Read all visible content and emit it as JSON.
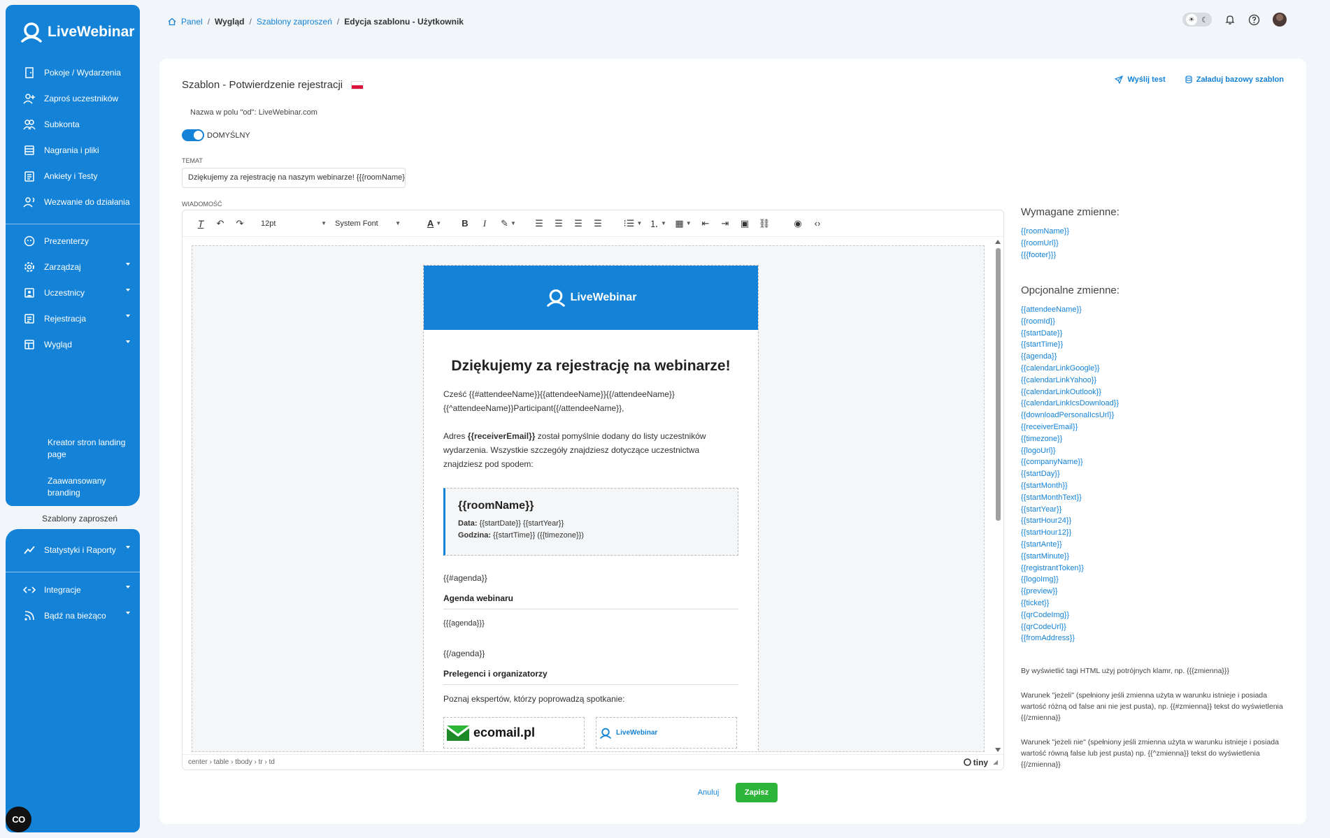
{
  "app": {
    "name": "LiveWebinar"
  },
  "sidebar": {
    "items": [
      {
        "label": "Pokoje / Wydarzenia",
        "icon": "door-icon"
      },
      {
        "label": "Zaproś uczestników",
        "icon": "user-plus-icon"
      },
      {
        "label": "Subkonta",
        "icon": "users-icon"
      },
      {
        "label": "Nagrania i pliki",
        "icon": "recordings-icon"
      },
      {
        "label": "Ankiety i Testy",
        "icon": "survey-icon"
      },
      {
        "label": "Wezwanie do działania",
        "icon": "call-to-action-icon"
      },
      {
        "label": "Prezenterzy",
        "icon": "presenter-icon"
      },
      {
        "label": "Zarządzaj",
        "icon": "gear-icon"
      },
      {
        "label": "Uczestnicy",
        "icon": "participants-icon"
      },
      {
        "label": "Rejestracja",
        "icon": "registration-icon"
      },
      {
        "label": "Wygląd",
        "icon": "layout-icon"
      },
      {
        "label": "Statystyki i Raporty",
        "icon": "chart-icon"
      },
      {
        "label": "Integracje",
        "icon": "integration-icon"
      },
      {
        "label": "Bądź na bieżąco",
        "icon": "rss-icon"
      }
    ],
    "subitems": [
      "Kreator stron landing page",
      "Zaawansowany branding",
      "Szablony zaproszeń"
    ],
    "badge": "CO"
  },
  "breadcrumb": {
    "home": "Panel",
    "section": "Wygląd",
    "templates": "Szablony zaproszeń",
    "current": "Edycja szablonu - Użytkownik"
  },
  "page": {
    "title": "Szablon - Potwierdzenie rejestracji",
    "send_test": "Wyślij test",
    "load_base": "Załaduj bazowy szablon",
    "from_name": "Nazwa w polu \"od\": LiveWebinar.com",
    "default_toggle": "DOMYŚLNY",
    "subject_label": "TEMAT",
    "subject_value": "Dziękujemy za rejestrację na naszym webinarze! {{{roomName}}}",
    "message_label": "WIADOMOŚĆ"
  },
  "editor": {
    "font_size": "12pt",
    "font_family": "System Font",
    "path": "center › table › tbody › tr › td",
    "brand": "tiny"
  },
  "email": {
    "logo": "LiveWebinar",
    "heading": "Dziękujemy za rejestrację na webinarze!",
    "greeting_1": "Cześć {{#attendeeName}}{{attendeeName}}{{/attendeeName}}",
    "greeting_2": "{{^attendeeName}}Participant{{/attendeeName}},",
    "address_prefix": "Adres ",
    "address_var": "{{receiverEmail}}",
    "address_rest": " został pomyślnie dodany do listy uczestników wydarzenia. Wszystkie szczegóły znajdziesz dotyczące uczestnictwa znajdziesz pod spodem:",
    "room": "{{roomName}}",
    "date_label": "Data:",
    "date_value": " {{startDate}} {{startYear}}",
    "time_label": "Godzina:",
    "time_value": " {{startTime}} ({{timezone}})",
    "agenda_open": "{{#agenda}}",
    "agenda_title": "Agenda webinaru",
    "agenda_value": "{{{agenda}}}",
    "agenda_close": "{{/agenda}}",
    "speakers_title": "Prelegenci i organizatorzy",
    "speakers_sub": "Poznaj ekspertów, którzy poprowadzą spotkanie:",
    "partner_1": "ecomail.pl",
    "partner_2": "LiveWebinar"
  },
  "variables": {
    "required_title": "Wymagane zmienne:",
    "required": [
      "{{roomName}}",
      "{{roomUrl}}",
      "{{{footer}}}"
    ],
    "optional_title": "Opcjonalne zmienne:",
    "optional": [
      "{{attendeeName}}",
      "{{roomId}}",
      "{{startDate}}",
      "{{startTime}}",
      "{{agenda}}",
      "{{calendarLinkGoogle}}",
      "{{calendarLinkYahoo}}",
      "{{calendarLinkOutlook}}",
      "{{calendarLinkIcsDownload}}",
      "{{downloadPersonalIcsUrl}}",
      "{{receiverEmail}}",
      "{{timezone}}",
      "{{logoUrl}}",
      "{{companyName}}",
      "{{startDay}}",
      "{{startMonth}}",
      "{{startMonthText}}",
      "{{startYear}}",
      "{{startHour24}}",
      "{{startHour12}}",
      "{{startAnte}}",
      "{{startMinute}}",
      "{{registrantToken}}",
      "{{logoImg}}",
      "{{preview}}",
      "{{ticket}}",
      "{{qrCodeImg}}",
      "{{qrCodeUrl}}",
      "{{fromAddress}}"
    ],
    "note_1": "By wyświetlić tagi HTML użyj potrójnych klamr, np. {{{zmienna}}}",
    "note_2": "Warunek \"jeżeli\" (spełniony jeśli zmienna użyta w warunku istnieje i posiada wartość różną od false ani nie jest pusta), np. {{#zmienna}} tekst do wyświetlenia {{/zmienna}}",
    "note_3": "Warunek \"jeżeli nie\" (spełniony jeśli zmienna użyta w warunku istnieje i posiada wartość równą false lub jest pusta) np. {{^zmienna}} tekst do wyświetlenia {{/zmienna}}"
  },
  "buttons": {
    "cancel": "Anuluj",
    "save": "Zapisz"
  },
  "colors": {
    "brand": "#1382d7",
    "save": "#2db53a",
    "background": "#f2f5f9"
  }
}
